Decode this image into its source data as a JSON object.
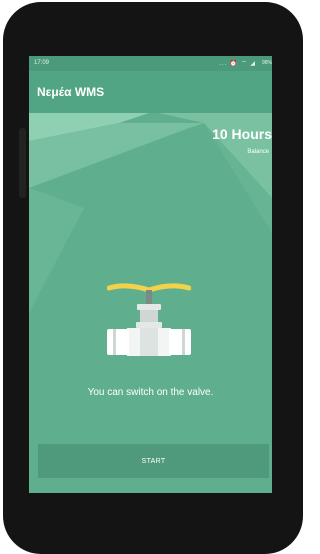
{
  "status_bar": {
    "time": "17:09",
    "icons": "... ⏰ ⌔ ◢",
    "battery": "98%"
  },
  "app_bar": {
    "title": "Νεμέα WMS"
  },
  "balance": {
    "value": "10 Hours",
    "label": "Balance"
  },
  "valve": {
    "icon": "valve-icon"
  },
  "message": "You can switch on the valve.",
  "start_button": {
    "label": "START"
  },
  "colors": {
    "screen_background": "#5faf8f",
    "app_bar": "#52a584",
    "status_bar": "#4a9a7b",
    "button": "#4f9a7c",
    "valve_handle": "#f2d24a"
  }
}
